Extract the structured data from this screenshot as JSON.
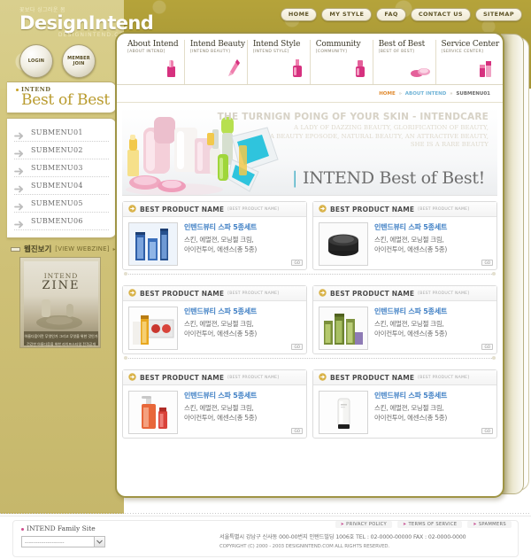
{
  "header": {
    "logo_tagline_kr": "꽃보다 싱그러운 봄",
    "logo_main": "DesignIntend",
    "logo_domain": "DESIGNINTEND.COM",
    "login_label": "LOGIN",
    "member_join_label_1": "MEMBER",
    "member_join_label_2": "JOIN",
    "topnav": [
      {
        "label": "HOME"
      },
      {
        "label": "MY STYLE"
      },
      {
        "label": "FAQ"
      },
      {
        "label": "CONTACT US"
      },
      {
        "label": "SITEMAP"
      }
    ]
  },
  "sidebar": {
    "kicker": "INTEND",
    "title": "Best of Best",
    "items": [
      {
        "label": "SUBMENU01",
        "icon": "arrow-right-icon"
      },
      {
        "label": "SUBMENU02",
        "icon": "arrow-right-icon"
      },
      {
        "label": "SUBMENU03",
        "icon": "arrow-right-icon"
      },
      {
        "label": "SUBMENU04",
        "icon": "arrow-right-icon"
      },
      {
        "label": "SUBMENU05",
        "icon": "arrow-right-icon"
      },
      {
        "label": "SUBMENU06",
        "icon": "arrow-right-icon"
      }
    ],
    "webzine": {
      "title_kr": "웹진보기",
      "title_en": "[VIEW WEBZINE]",
      "dots": "▸▸▸",
      "cover_line1": "INTEND",
      "cover_line2": "ZINE",
      "cover_caption1": "아름다움이란 무엇인가 그리고 무엇을 위한 것인가",
      "cover_caption2": "건강한 아름다움을 위한 라이프스타일 전격공개"
    }
  },
  "mainnav": [
    {
      "title": "About Intend",
      "sub": "[ABOUT INTEND]",
      "icon": "lipstick-icon"
    },
    {
      "title": "Intend Beauty",
      "sub": "[INTEND BEAUTY]",
      "icon": "mascara-icon"
    },
    {
      "title": "Intend Style",
      "sub": "[INTEND STYLE]",
      "icon": "nailpolish-icon"
    },
    {
      "title": "Community",
      "sub": "[COMMUNITY]",
      "icon": "bottle-icon"
    },
    {
      "title": "Best of Best",
      "sub": "[BEST OF BEST]",
      "icon": "compact-icon"
    },
    {
      "title": "Service Center",
      "sub": "[SERVICE CENTER]",
      "icon": "cosmetics-icon"
    }
  ],
  "breadcrumb": {
    "home": "HOME",
    "sep": "»",
    "mid": "ABOUT INTEND",
    "current": "SUBMENU01"
  },
  "hero": {
    "headline": "THE TURNIGN POING OF YOUR SKIN - INTENDCARE",
    "sub_line1": "A LADY OF DAZZING BEAUTY, GLORIFICATION OF BEAUTY,",
    "sub_line2": "A BEAUTY EPOSODE, NATURAL BEAUTY, AN ATTRACTIVE BEAUTY,",
    "sub_line3": "SHE IS A RARE BEAUTY",
    "bar": "|",
    "title": "INTEND Best of Best!"
  },
  "products": {
    "card_title": "BEST PRODUCT NAME",
    "card_title_alt": "[BEST PRODUCT NAME]",
    "go_label": "GO",
    "items": [
      {
        "name": "인텐드뷰티 스파 5종세트",
        "desc_line1": "스킨, 에멀젼, 모닝젤 크림,",
        "desc_line2": "아이컨투어, 에센스(총 5종)",
        "thumb": "blue-bottles-thumb"
      },
      {
        "name": "인텐드뷰티 스파 5종세트",
        "desc_line1": "스킨, 에멀젼, 모닝젤 크림,",
        "desc_line2": "아이컨투어, 에센스(총 5종)",
        "thumb": "black-jar-thumb"
      },
      {
        "name": "인텐드뷰티 스파 5종세트",
        "desc_line1": "스킨, 에멀젼, 모닝젤 크림,",
        "desc_line2": "아이컨투어, 에센스(총 5종)",
        "thumb": "makeup-palette-thumb"
      },
      {
        "name": "인텐드뷰티 스파 5종세트",
        "desc_line1": "스킨, 에멀젼, 모닝젤 크림,",
        "desc_line2": "아이컨투어, 에센스(총 5종)",
        "thumb": "green-bottles-thumb"
      },
      {
        "name": "인텐드뷰티 스파 5종세트",
        "desc_line1": "스킨, 에멀젼, 모닝젤 크림,",
        "desc_line2": "아이컨투어, 에센스(총 5종)",
        "thumb": "orange-pump-thumb"
      },
      {
        "name": "인텐드뷰티 스파 5종세트",
        "desc_line1": "스킨, 에멀젼, 모닝젤 크림,",
        "desc_line2": "아이컨투어, 에센스(총 5종)",
        "thumb": "white-tube-thumb"
      }
    ]
  },
  "footer": {
    "family_site_label": "INTEND Family Site",
    "family_site_value": "-------------------",
    "links": [
      {
        "label": "PRIVACY POLICY"
      },
      {
        "label": "TERMS OF SERVICE"
      },
      {
        "label": "SPAMMERS"
      }
    ],
    "address": "서울특별시  강남구 신사동 000-00번지 인텐드빌딩 1006호  TEL : 02-0000-00000  FAX : 02-0000-0000",
    "copyright": "COPYRIGHT (C) 2000 - 2003 DESIGNINTEND.COM  ALL RIGHTS RESERVED."
  },
  "colors": {
    "gold_dark": "#a89734",
    "gold_light": "#cfc177",
    "panel_border": "#9f9445",
    "accent_title": "#b99b2e",
    "product_link": "#3f7fc4",
    "crumb_home": "#e08a2e",
    "crumb_mid": "#6fb3d6",
    "hero_accent": "#4fb3c8",
    "pink": "#d6317f"
  }
}
